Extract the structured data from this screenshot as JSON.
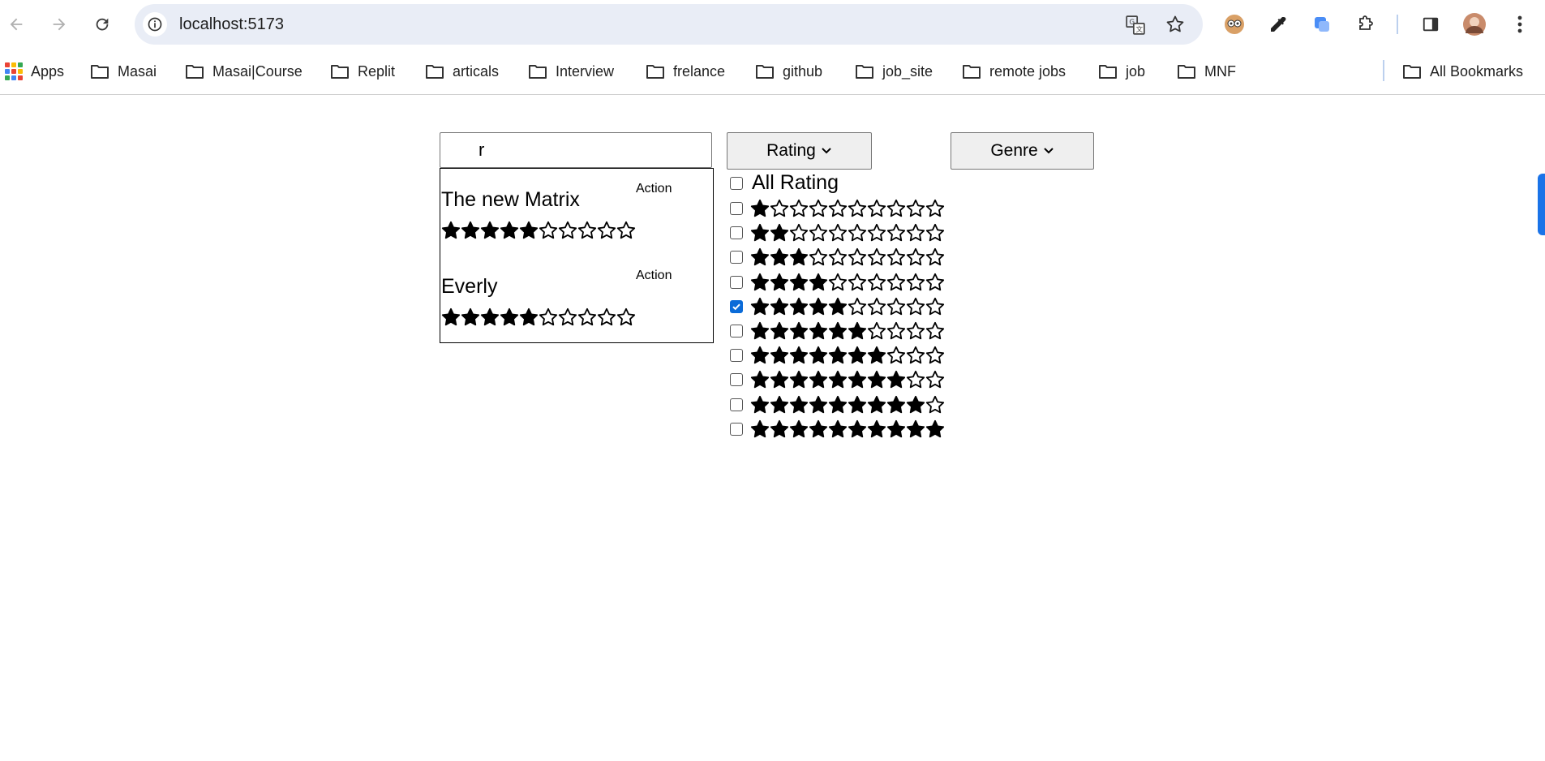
{
  "browser": {
    "url": "localhost:5173",
    "bookmarks": [
      {
        "label": "Apps"
      },
      {
        "label": "Masai"
      },
      {
        "label": "Masai|Course"
      },
      {
        "label": "Replit"
      },
      {
        "label": "articals"
      },
      {
        "label": "Interview"
      },
      {
        "label": "frelance"
      },
      {
        "label": "github"
      },
      {
        "label": "job_site"
      },
      {
        "label": "remote jobs"
      },
      {
        "label": "job"
      },
      {
        "label": "MNF"
      }
    ],
    "all_bookmarks_label": "All Bookmarks"
  },
  "search": {
    "value": "r"
  },
  "results": [
    {
      "title": "The new Matrix",
      "genre": "Action",
      "rating": 5,
      "max_rating": 10
    },
    {
      "title": "Everly",
      "genre": "Action",
      "rating": 5,
      "max_rating": 10
    }
  ],
  "rating_dropdown": {
    "label": "Rating",
    "all_label": "All Rating",
    "all_checked": false,
    "max_stars": 10,
    "options": [
      {
        "stars": 1,
        "checked": false
      },
      {
        "stars": 2,
        "checked": false
      },
      {
        "stars": 3,
        "checked": false
      },
      {
        "stars": 4,
        "checked": false
      },
      {
        "stars": 5,
        "checked": true
      },
      {
        "stars": 6,
        "checked": false
      },
      {
        "stars": 7,
        "checked": false
      },
      {
        "stars": 8,
        "checked": false
      },
      {
        "stars": 9,
        "checked": false
      },
      {
        "stars": 10,
        "checked": false
      }
    ]
  },
  "genre_dropdown": {
    "label": "Genre"
  },
  "colors": {
    "checkbox_checked": "#0b6bd8",
    "accent": "#1a73e8"
  }
}
